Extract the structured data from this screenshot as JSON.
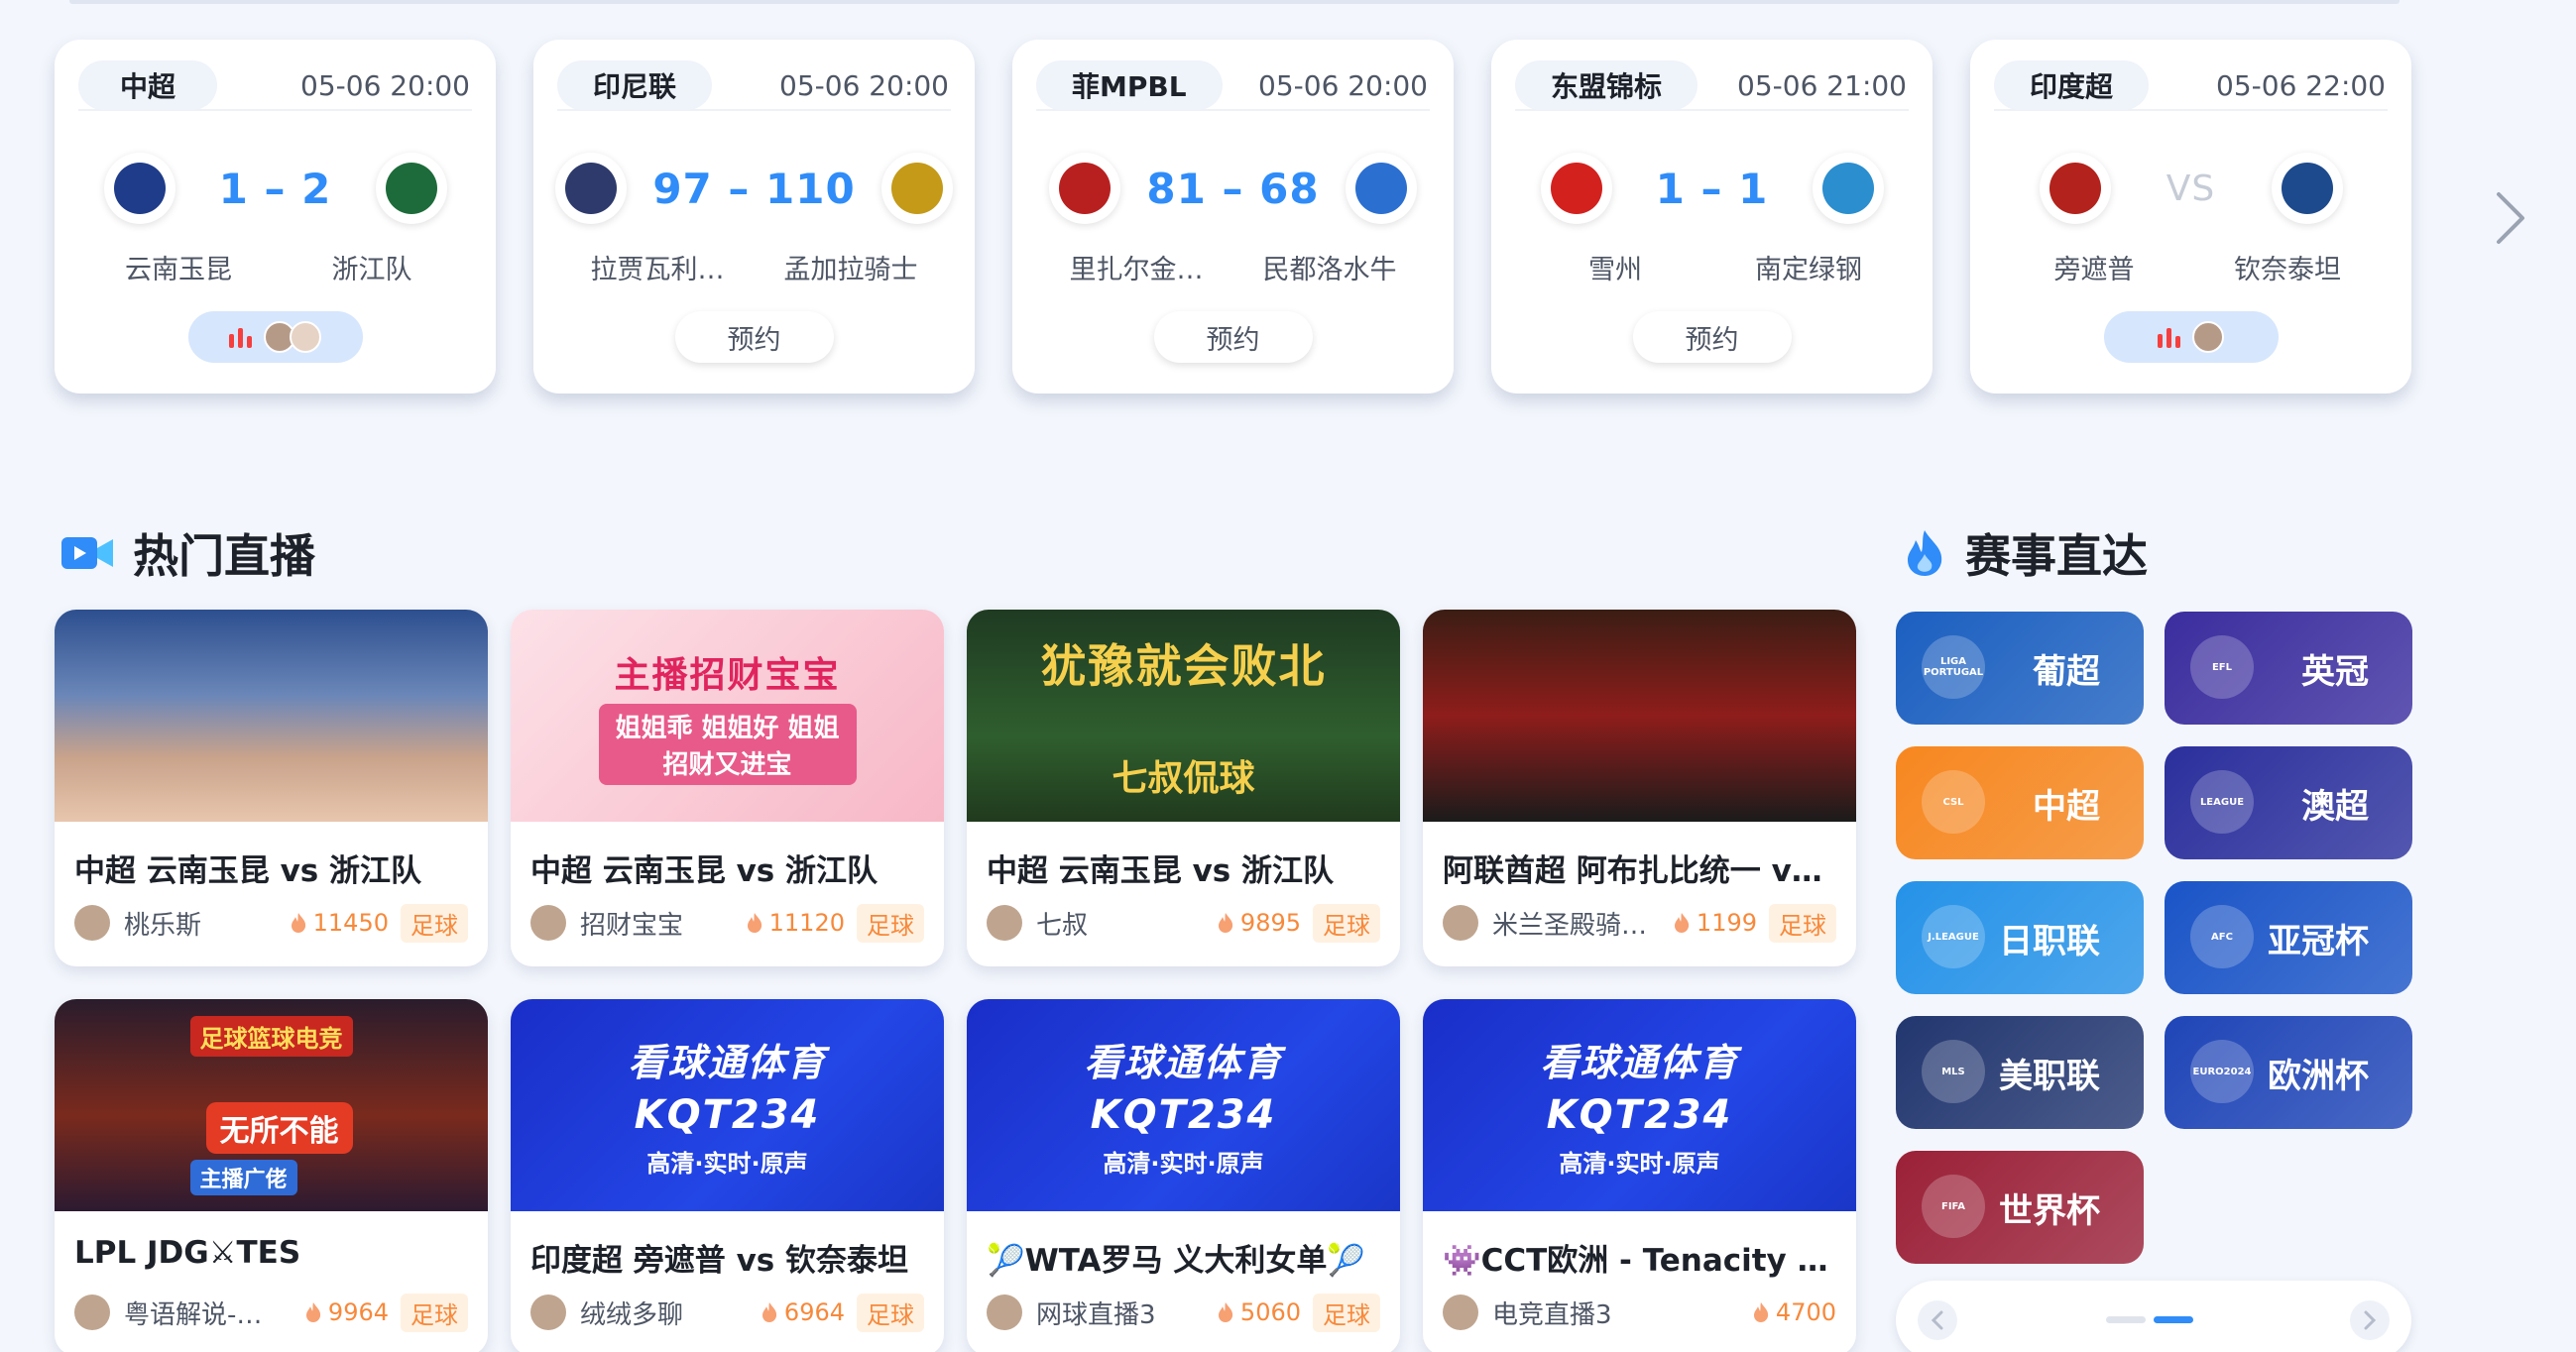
{
  "matches": [
    {
      "league": "中超",
      "time": "05-06 20:00",
      "home": "云南玉昆",
      "away": "浙江队",
      "score": "1 – 2",
      "status": "live",
      "home_color": "#1f3c8a",
      "away_color": "#1d6b3a"
    },
    {
      "league": "印尼联",
      "time": "05-06 20:00",
      "home": "拉贾瓦利…",
      "away": "孟加拉骑士",
      "score": "97 – 110",
      "status": "reserve",
      "button": "预约",
      "home_color": "#2d3a6b",
      "away_color": "#c49a18"
    },
    {
      "league": "菲MPBL",
      "time": "05-06 20:00",
      "home": "里扎尔金…",
      "away": "民都洛水牛",
      "score": "81 – 68",
      "status": "reserve",
      "button": "预约",
      "home_color": "#b8201f",
      "away_color": "#2b6fd1"
    },
    {
      "league": "东盟锦标",
      "time": "05-06 21:00",
      "home": "雪州",
      "away": "南定绿钢",
      "score": "1 – 1",
      "status": "reserve",
      "button": "预约",
      "home_color": "#d3211e",
      "away_color": "#2a8ecf"
    },
    {
      "league": "印度超",
      "time": "05-06 22:00",
      "home": "旁遮普",
      "away": "钦奈泰坦",
      "score": "VS",
      "status": "live",
      "home_color": "#b3221c",
      "away_color": "#1d4a8c"
    }
  ],
  "hot_live": {
    "title": "热门直播",
    "items": [
      {
        "title": "中超 云南玉昆 vs 浙江队",
        "anchor": "桃乐斯",
        "heat": "11450",
        "tag": "足球",
        "thumb_text": "",
        "thumb": "anime"
      },
      {
        "title": "中超 云南玉昆 vs 浙江队",
        "anchor": "招财宝宝",
        "heat": "11120",
        "tag": "足球",
        "thumb_text": "主播招财宝宝",
        "thumb_sub": "姐姐乖 姐姐好 姐姐招财又进宝",
        "thumb": "pink"
      },
      {
        "title": "中超 云南玉昆 vs 浙江队",
        "anchor": "七叔",
        "heat": "9895",
        "tag": "足球",
        "thumb_text": "犹豫就会败北",
        "thumb_sub": "七叔侃球",
        "thumb": "green"
      },
      {
        "title": "阿联酋超 阿布扎比统一 vs …",
        "anchor": "米兰圣殿骑…",
        "heat": "1199",
        "tag": "足球",
        "thumb_text": "",
        "thumb": "milan"
      },
      {
        "title": "LPL JDG⚔TES",
        "anchor": "粤语解说-…",
        "heat": "9964",
        "tag": "足球",
        "thumb_text": "足球篮球电竞",
        "thumb_sub": "无所不能",
        "thumb_foot": "主播广佬",
        "thumb": "storm"
      },
      {
        "title": "印度超 旁遮普 vs 钦奈泰坦",
        "anchor": "绒绒多聊",
        "heat": "6964",
        "tag": "足球",
        "thumb_text": "看球通体育",
        "thumb_sub": "KQT234",
        "thumb_foot": "高清·实时·原声",
        "thumb": "blue"
      },
      {
        "title": "🎾WTA罗马 义大利女单🎾",
        "anchor": "网球直播3",
        "heat": "5060",
        "tag": "足球",
        "thumb_text": "看球通体育",
        "thumb_sub": "KQT234",
        "thumb_foot": "高清·实时·原声",
        "thumb": "blue"
      },
      {
        "title": "👾CCT欧洲 - Tenacity vs…",
        "anchor": "电竞直播3",
        "heat": "4700",
        "tag": "",
        "thumb_text": "看球通体育",
        "thumb_sub": "KQT234",
        "thumb_foot": "高清·实时·原声",
        "thumb": "blue"
      }
    ]
  },
  "competitions": {
    "title": "赛事直达",
    "items": [
      {
        "label": "葡超",
        "color": "#1b5fc0",
        "emblem": "LIGA PORTUGAL"
      },
      {
        "label": "英冠",
        "color": "#3b2d9e",
        "emblem": "EFL"
      },
      {
        "label": "中超",
        "color": "#f7871f",
        "emblem": "CSL"
      },
      {
        "label": "澳超",
        "color": "#2b2f9c",
        "emblem": "LEAGUE"
      },
      {
        "label": "日职联",
        "color": "#2592e8",
        "emblem": "J.LEAGUE"
      },
      {
        "label": "亚冠杯",
        "color": "#1a54c7",
        "emblem": "AFC"
      },
      {
        "label": "美职联",
        "color": "#22366f",
        "emblem": "MLS"
      },
      {
        "label": "欧洲杯",
        "color": "#1f45b7",
        "emblem": "EURO2024"
      },
      {
        "label": "世界杯",
        "color": "#9b2037",
        "emblem": "FIFA"
      }
    ]
  }
}
